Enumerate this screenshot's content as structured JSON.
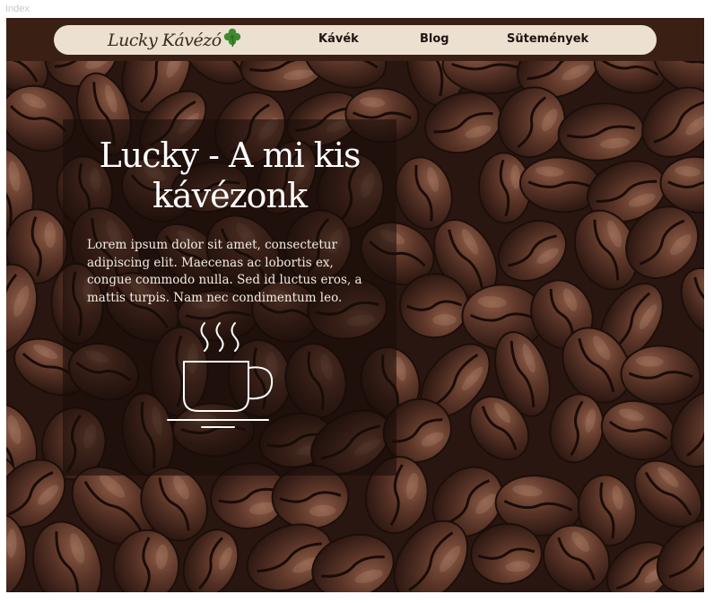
{
  "tab": {
    "title": "Index"
  },
  "header": {
    "logo_text": "Lucky Kávézó",
    "nav": [
      {
        "label": "Kávék"
      },
      {
        "label": "Blog"
      },
      {
        "label": "Sütemények"
      }
    ]
  },
  "hero": {
    "title": "Lucky - A mi kis kávézonk",
    "body": "Lorem ipsum dolor sit amet, consectetur adipiscing elit. Maecenas ac lobortis ex, congue commodo nulla. Sed id luctus eros, a mattis turpis. Nam nec condimentum leo.",
    "icon": "coffee-cup-icon"
  },
  "colors": {
    "nav_bg": "#ece1d0",
    "header_bg": "#3a2014",
    "bean_dark": "#2d1810",
    "card_overlay": "rgba(24,12,8,0.58)"
  }
}
